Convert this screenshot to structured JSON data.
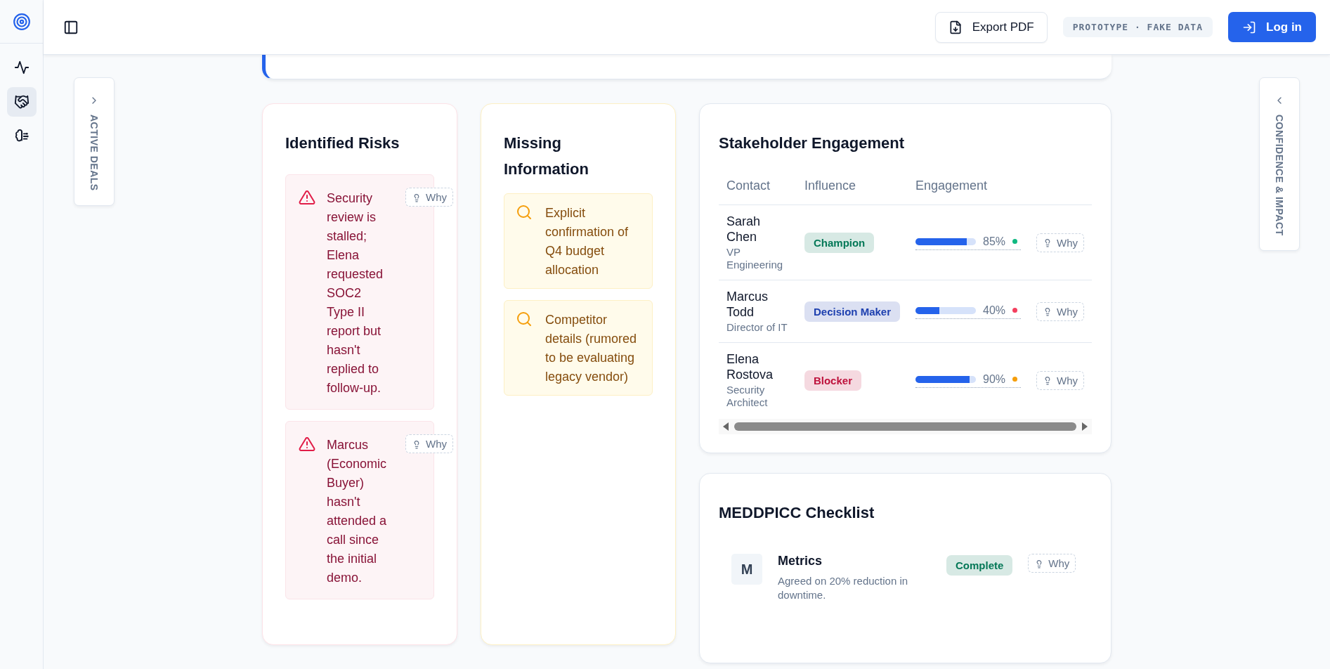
{
  "rail": {
    "nav": [
      {
        "selected": false
      },
      {
        "selected": true
      },
      {
        "selected": false
      }
    ]
  },
  "header": {
    "export_button": "Export PDF",
    "badge": "PROTOTYPE · FAKE DATA",
    "login_button": "Log in"
  },
  "left_panel": {
    "label": "ACTIVE DEALS"
  },
  "right_panel": {
    "label": "CONFIDENCE & IMPACT"
  },
  "risks": {
    "title": "Identified Risks",
    "items": [
      {
        "text": "Security review is stalled; Elena requested SOC2 Type II report but hasn't replied to follow-up.",
        "why": "Why"
      },
      {
        "text": "Marcus (Economic Buyer) hasn't attended a call since the initial demo.",
        "why": "Why"
      }
    ]
  },
  "missing": {
    "title": "Missing Information",
    "items": [
      {
        "text": "Explicit confirmation of Q4 budget allocation"
      },
      {
        "text": "Competitor details (rumored to be evaluating legacy vendor)"
      }
    ]
  },
  "stakeholders": {
    "title": "Stakeholder Engagement",
    "columns": [
      "Contact",
      "Influence",
      "Engagement"
    ],
    "rows": [
      {
        "name": "Sarah Chen",
        "role": "VP Engineering",
        "influence": {
          "label": "Champion",
          "color": "#047857"
        },
        "level": 0.85,
        "reading": "85%",
        "color": "#10b981",
        "why": "Why"
      },
      {
        "name": "Marcus Todd",
        "role": "Director of IT",
        "influence": {
          "label": "Decision Maker",
          "color": "#1e40af"
        },
        "level": 0.4,
        "reading": "40%",
        "color": "#f43f5e",
        "why": "Why"
      },
      {
        "name": "Elena Rostova",
        "role": "Security Architect",
        "influence": {
          "label": "Blocker",
          "color": "#be123c"
        },
        "level": 0.9,
        "reading": "90%",
        "color": "#f59e0b",
        "why": "Why"
      }
    ]
  },
  "meddpicc": {
    "title": "MEDDPICC Checklist",
    "items": [
      {
        "letter": "M",
        "name": "Metrics",
        "detail": "Agreed on 20% reduction in downtime.",
        "status": {
          "label": "Complete",
          "color": "#047857"
        },
        "why": "Why"
      }
    ]
  }
}
